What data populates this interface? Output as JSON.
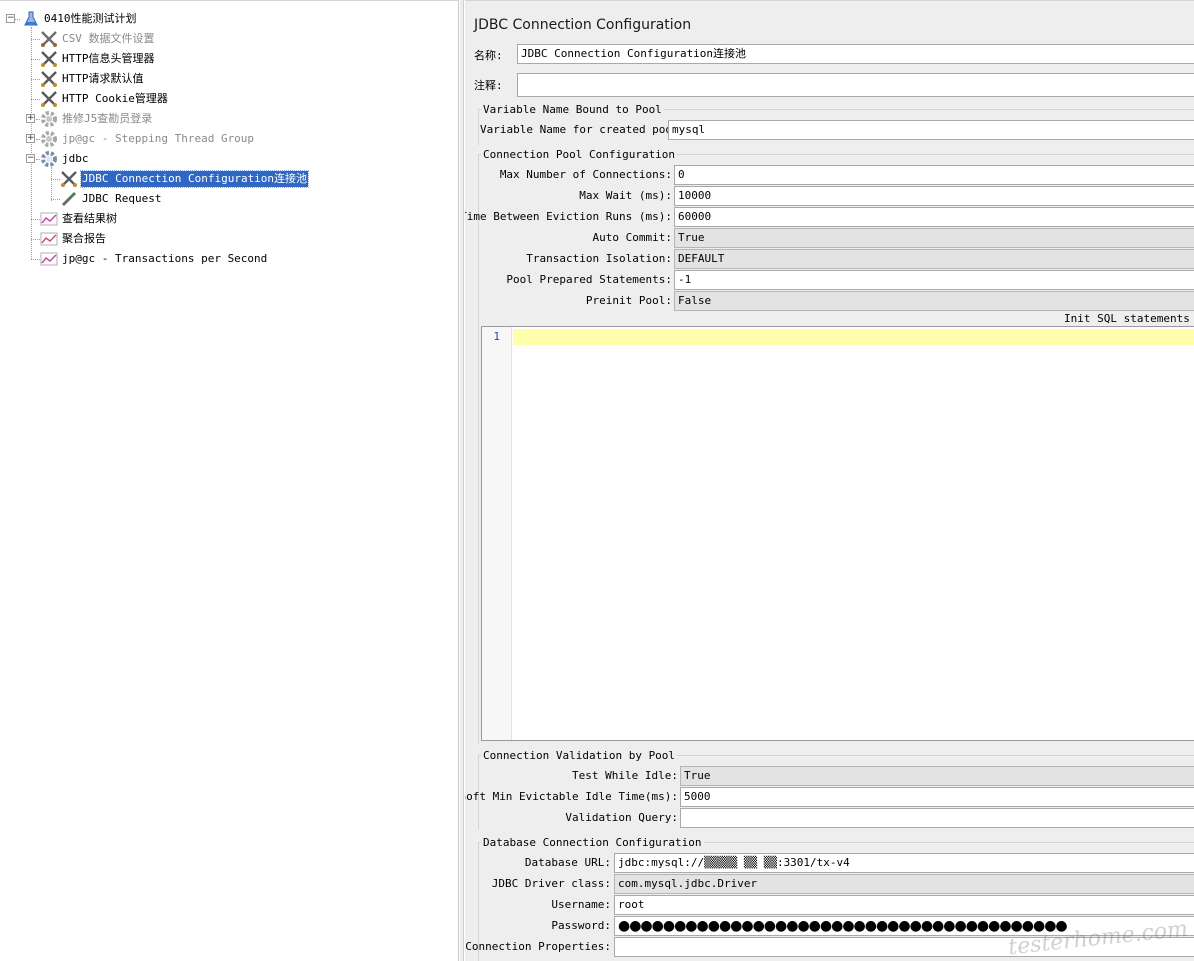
{
  "tree": {
    "root": {
      "label": "0410性能测试计划",
      "expander": "−",
      "icon": "flask-icon"
    },
    "items": [
      {
        "label": "CSV 数据文件设置",
        "icon": "scissors-icon",
        "gray": true
      },
      {
        "label": "HTTP信息头管理器",
        "icon": "scissors-icon",
        "gray": false
      },
      {
        "label": "HTTP请求默认值",
        "icon": "scissors-icon",
        "gray": false
      },
      {
        "label": "HTTP Cookie管理器",
        "icon": "scissors-icon",
        "gray": false
      },
      {
        "label": "推修J5查勘员登录",
        "icon": "gear-icon",
        "gray": true,
        "expander": "+"
      },
      {
        "label": "jp@gc - Stepping Thread Group",
        "icon": "gear-icon",
        "gray": true,
        "expander": "+"
      },
      {
        "label": "jdbc",
        "icon": "gear-icon",
        "gray": false,
        "expander": "−"
      },
      {
        "label": "JDBC Connection Configuration连接池",
        "icon": "scissors-icon",
        "selected": true
      },
      {
        "label": "JDBC Request",
        "icon": "pipette-icon",
        "gray": false
      },
      {
        "label": "查看结果树",
        "icon": "chart-icon",
        "gray": false
      },
      {
        "label": "聚合报告",
        "icon": "chart-icon",
        "gray": false
      },
      {
        "label": "jp@gc - Transactions per Second",
        "icon": "chart-icon",
        "gray": false
      }
    ]
  },
  "config": {
    "title": "JDBC Connection Configuration",
    "name_label": "名称:",
    "name_value": "JDBC Connection Configuration连接池",
    "comment_label": "注释:",
    "comment_value": "",
    "variable_group": {
      "title": "Variable Name Bound to Pool",
      "label": "Variable Name for created pool:",
      "value": "mysql"
    },
    "pool_group": {
      "title": "Connection Pool Configuration",
      "fields": [
        {
          "label": "Max Number of Connections:",
          "value": "0",
          "combo": false
        },
        {
          "label": "Max Wait (ms):",
          "value": "10000",
          "combo": false
        },
        {
          "label": "Time Between Eviction Runs (ms):",
          "value": "60000",
          "combo": false
        },
        {
          "label": "Auto Commit:",
          "value": "True",
          "combo": true
        },
        {
          "label": "Transaction Isolation:",
          "value": "DEFAULT",
          "combo": true
        },
        {
          "label": "Pool Prepared Statements:",
          "value": "-1",
          "combo": false
        },
        {
          "label": "Preinit Pool:",
          "value": "False",
          "combo": true
        }
      ],
      "init_sql_label": "Init SQL statements se",
      "sql_line_number": "1"
    },
    "validation_group": {
      "title": "Connection Validation by Pool",
      "fields": [
        {
          "label": "Test While Idle:",
          "value": "True",
          "combo": true
        },
        {
          "label": "Soft Min Evictable Idle Time(ms):",
          "value": "5000",
          "combo": false
        },
        {
          "label": "Validation Query:",
          "value": "",
          "combo": false
        }
      ]
    },
    "database_group": {
      "title": "Database Connection Configuration",
      "fields": [
        {
          "label": "Database URL:",
          "value": "jdbc:mysql://▒▒▒▒▒ ▒▒ ▒▒:3301/tx-v4",
          "combo": false
        },
        {
          "label": "JDBC Driver class:",
          "value": "com.mysql.jdbc.Driver",
          "combo": true
        },
        {
          "label": "Username:",
          "value": "root",
          "combo": false
        },
        {
          "label": "Password:",
          "value": "●●●●●●●●●●●●●●●●●●●●●●●●●●●●●●●●●●●●●●●●",
          "combo": false
        },
        {
          "label": "Connection Properties:",
          "value": "",
          "combo": false
        }
      ]
    }
  },
  "watermark": "testerhome.com"
}
